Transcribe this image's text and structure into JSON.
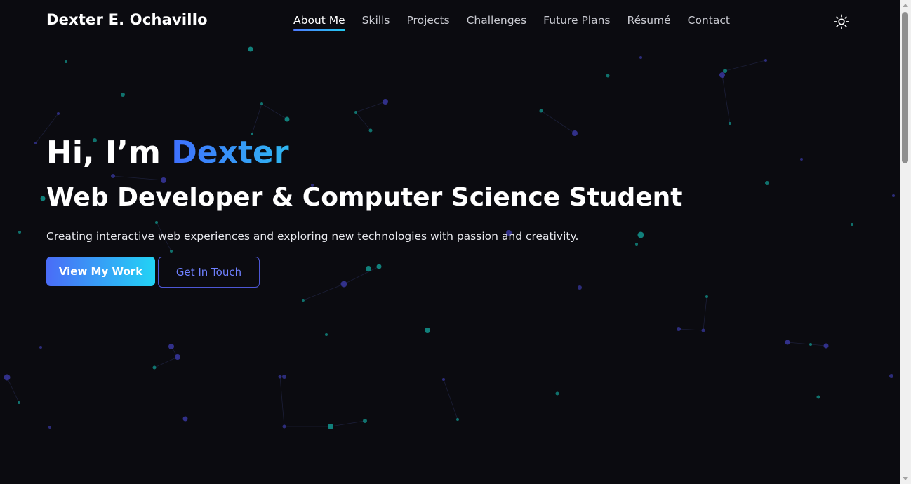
{
  "site": {
    "brand": "Dexter E. Ochavillo"
  },
  "nav": {
    "items": [
      {
        "label": "About Me",
        "active": true
      },
      {
        "label": "Skills",
        "active": false
      },
      {
        "label": "Projects",
        "active": false
      },
      {
        "label": "Challenges",
        "active": false
      },
      {
        "label": "Future Plans",
        "active": false
      },
      {
        "label": "Résumé",
        "active": false
      },
      {
        "label": "Contact",
        "active": false
      }
    ],
    "theme_toggle_icon": "sun-icon"
  },
  "hero": {
    "greeting_prefix": "Hi, I’m ",
    "name": "Dexter",
    "role": "Web Developer & Computer Science Student",
    "tagline": "Creating interactive web experiences and exploring new technologies with passion and creativity.",
    "primary_button": "View My Work",
    "secondary_button": "Get In Touch"
  },
  "colors": {
    "background": "#0b0b10",
    "accent_blue": "#3f6fff",
    "accent_cyan": "#22d3f5",
    "secondary_border": "#4d57d6",
    "particle_teal": "#139e96",
    "particle_indigo": "#3b3aa8"
  }
}
